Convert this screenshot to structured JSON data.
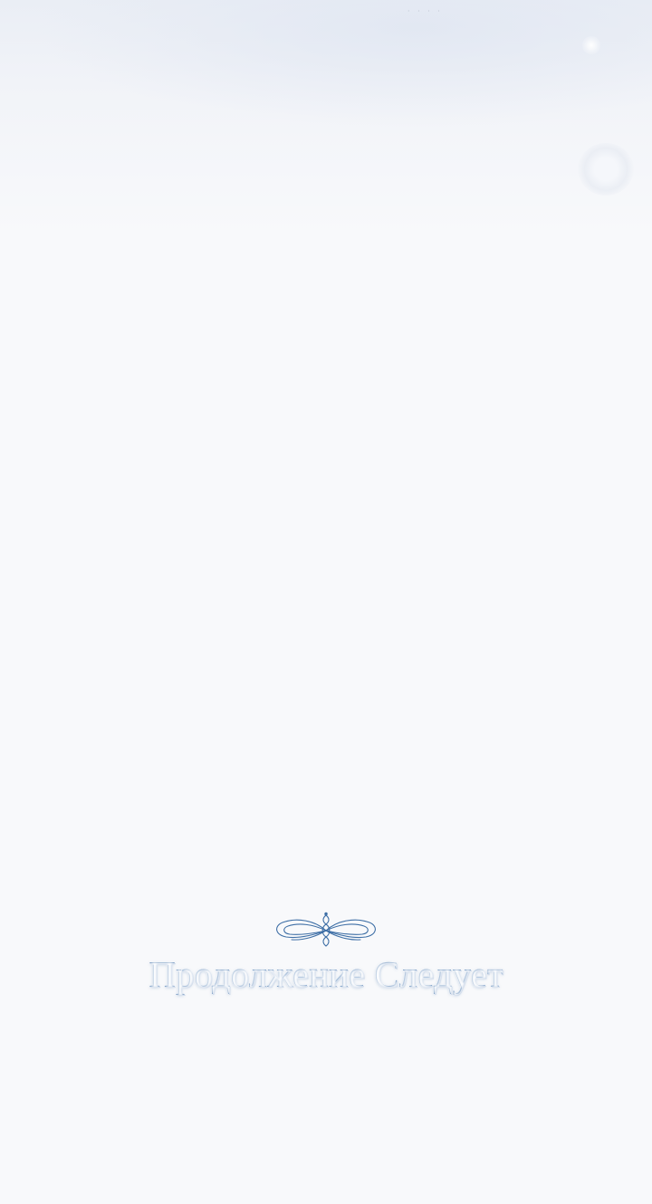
{
  "top_decoration": {
    "dots": "· · · ·"
  },
  "ending_banner": {
    "ornament_icon": "flourish-ornament-icon",
    "text": "Продолжение Следует"
  },
  "colors": {
    "background": "#f8f9fb",
    "title_blue": "#4672a8",
    "ornament_blue": "#3e6fa6"
  }
}
